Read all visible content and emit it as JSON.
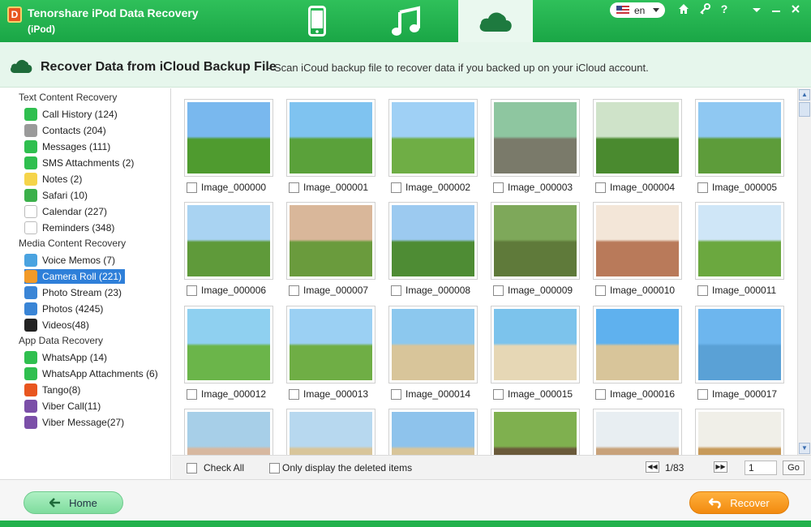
{
  "app": {
    "title": "Tenorshare iPod Data Recovery",
    "subtitle": "(iPod)",
    "logo_letter": "D"
  },
  "tabs": [
    {
      "icon": "ipod-device-icon",
      "active": false
    },
    {
      "icon": "music-note-icon",
      "active": false
    },
    {
      "icon": "cloud-icon",
      "active": true
    }
  ],
  "language": {
    "value": "en"
  },
  "header": {
    "title": "Recover Data from iCloud Backup File",
    "desc": "- Scan iCoud backup file to recover data if you backed up on your iCloud account."
  },
  "sidebar": {
    "sections": [
      {
        "title": "Text Content Recovery",
        "items": [
          {
            "label": "Call History (124)",
            "icon": "phone-icon",
            "color": "#2fbf4f"
          },
          {
            "label": "Contacts (204)",
            "icon": "contacts-icon",
            "color": "#9a9a9a"
          },
          {
            "label": "Messages (111)",
            "icon": "messages-icon",
            "color": "#2fbf4f"
          },
          {
            "label": "SMS Attachments (2)",
            "icon": "attachment-icon",
            "color": "#2fbf4f"
          },
          {
            "label": "Notes (2)",
            "icon": "notes-icon",
            "color": "#f5d44a"
          },
          {
            "label": "Safari (10)",
            "icon": "safari-icon",
            "color": "#3bb04a"
          },
          {
            "label": "Calendar (227)",
            "icon": "calendar-icon",
            "color": "#ffffff"
          },
          {
            "label": "Reminders (348)",
            "icon": "reminders-icon",
            "color": "#ffffff"
          }
        ]
      },
      {
        "title": "Media Content Recovery",
        "items": [
          {
            "label": "Voice Memos (7)",
            "icon": "microphone-icon",
            "color": "#4aa3e0"
          },
          {
            "label": "Camera Roll (221)",
            "icon": "camera-roll-icon",
            "color": "#f29a28",
            "selected": true
          },
          {
            "label": "Photo Stream (23)",
            "icon": "photo-stream-icon",
            "color": "#3a85d6"
          },
          {
            "label": "Photos (4245)",
            "icon": "photos-icon",
            "color": "#3a85d6"
          },
          {
            "label": "Videos(48)",
            "icon": "videos-icon",
            "color": "#222222"
          }
        ]
      },
      {
        "title": "App Data Recovery",
        "items": [
          {
            "label": "WhatsApp (14)",
            "icon": "whatsapp-icon",
            "color": "#2fbf4f"
          },
          {
            "label": "WhatsApp Attachments (6)",
            "icon": "whatsapp-attachment-icon",
            "color": "#2fbf4f"
          },
          {
            "label": "Tango(8)",
            "icon": "tango-icon",
            "color": "#e8561f"
          },
          {
            "label": "Viber Call(11)",
            "icon": "viber-call-icon",
            "color": "#7b4fa8"
          },
          {
            "label": "Viber Message(27)",
            "icon": "viber-message-icon",
            "color": "#7b4fa8"
          }
        ]
      }
    ]
  },
  "images": [
    {
      "name": "Image_000000"
    },
    {
      "name": "Image_000001"
    },
    {
      "name": "Image_000002"
    },
    {
      "name": "Image_000003"
    },
    {
      "name": "Image_000004"
    },
    {
      "name": "Image_000005"
    },
    {
      "name": "Image_000006"
    },
    {
      "name": "Image_000007"
    },
    {
      "name": "Image_000008"
    },
    {
      "name": "Image_000009"
    },
    {
      "name": "Image_000010"
    },
    {
      "name": "Image_000011"
    },
    {
      "name": "Image_000012"
    },
    {
      "name": "Image_000013"
    },
    {
      "name": "Image_000014"
    },
    {
      "name": "Image_000015"
    },
    {
      "name": "Image_000016"
    },
    {
      "name": "Image_000017"
    },
    {
      "name": ""
    },
    {
      "name": ""
    },
    {
      "name": ""
    },
    {
      "name": ""
    },
    {
      "name": ""
    },
    {
      "name": ""
    }
  ],
  "bottom": {
    "check_all": "Check All",
    "only_deleted": "Only display the deleted items",
    "page": "1/83",
    "page_input": "1",
    "go": "Go"
  },
  "footer": {
    "home": "Home",
    "recover": "Recover"
  },
  "colors": {
    "brand_green": "#22b14c",
    "accent_orange": "#f28a0f",
    "selection_blue": "#2e7fd9"
  }
}
